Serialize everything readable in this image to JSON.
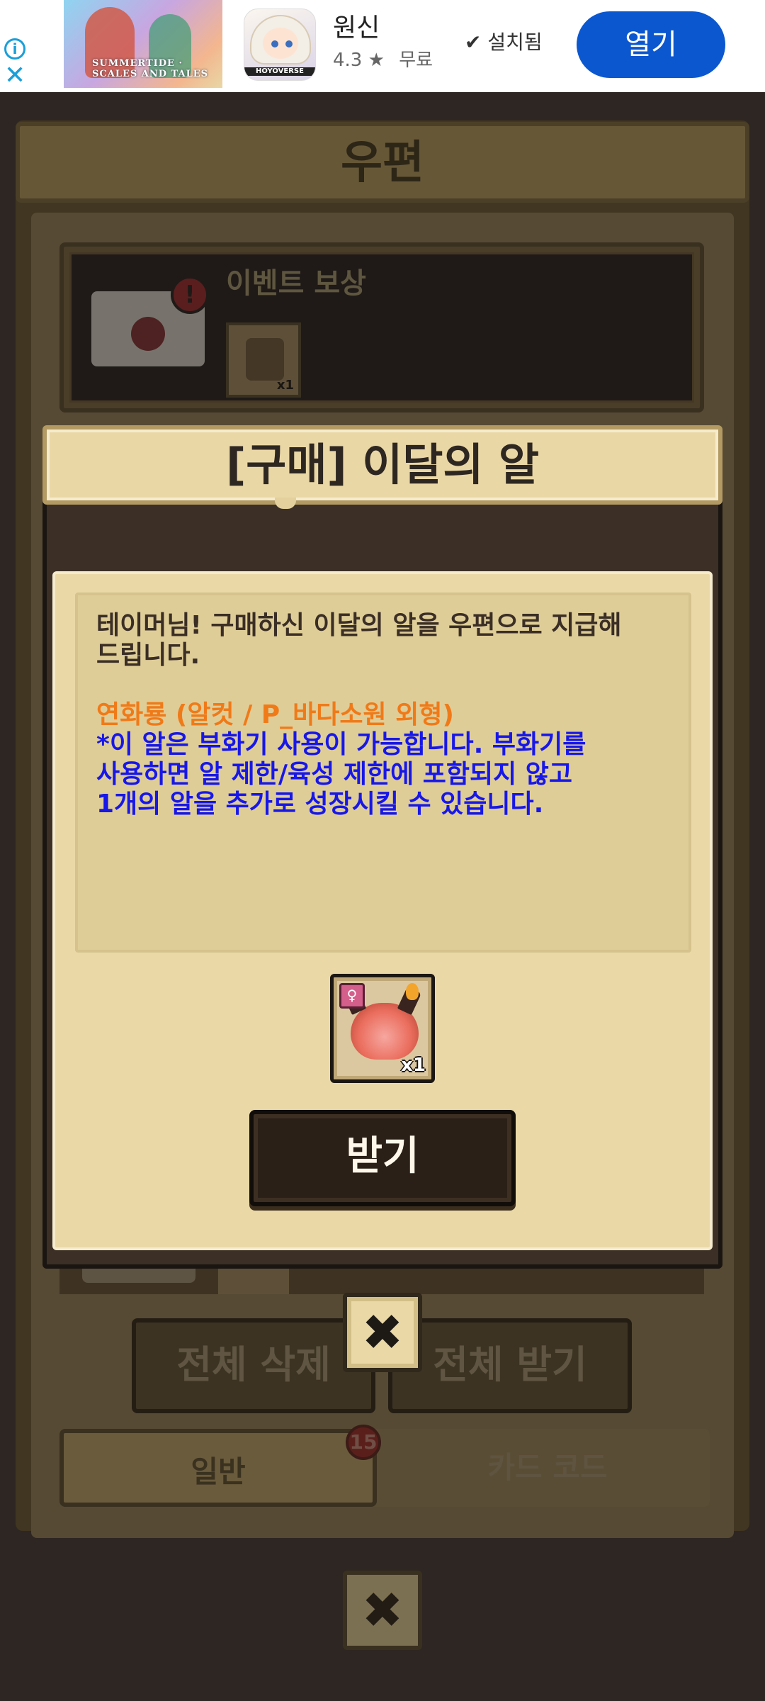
{
  "ad": {
    "banner_text": "SUMMERTIDE · SCALES AND TALES",
    "app_logo_text": "HOYOVERSE",
    "app_name": "원신",
    "rating": "4.3",
    "price": "무료",
    "installed_label": "설치됨",
    "open_button": "열기",
    "info_icon_glyph": "i",
    "close_icon_glyph": "✕"
  },
  "mailbox": {
    "title": "우편",
    "card": {
      "title": "이벤트 보상",
      "alert_glyph": "!",
      "item_qty": "x1"
    },
    "buttons": {
      "delete_all": "전체 삭제",
      "receive_all": "전체 받기"
    },
    "tabs": [
      {
        "label": "일반"
      },
      {
        "label": "카드 코드"
      }
    ],
    "badge_count": "15"
  },
  "dialog": {
    "title": "[구매] 이달의 알",
    "message": {
      "line1": "테이머님! 구매하신 이달의 알을 우편으로 지급해",
      "line2": "드립니다.",
      "line3": "연화룡 (알컷 / P_바다소원 외형)",
      "line4": "*이 알은 부화기 사용이 가능합니다. 부화기를",
      "line5": "사용하면 알 제한/육성 제한에 포함되지 않고",
      "line6": "1개의 알을 추가로 성장시킬 수 있습니다."
    },
    "reward_qty": "x1",
    "reward_type_glyph": "♀",
    "claim_button": "받기"
  },
  "icons": {
    "close_glyph": "✖",
    "star": "★",
    "installed_check": "✔"
  },
  "colors": {
    "ad_open_button": "#0b57d0",
    "message_orange": "#f07a18",
    "message_blue": "#1717e8",
    "panel_beige": "#ead9a7"
  }
}
